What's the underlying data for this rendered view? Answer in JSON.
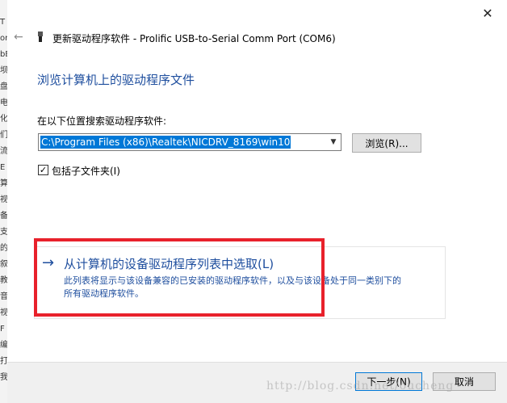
{
  "window": {
    "title": "更新驱动程序软件 - Prolific USB-to-Serial Comm Port (COM6)",
    "close_glyph": "✕",
    "back_glyph": "←"
  },
  "background_chars": [
    "T",
    "or",
    "bE",
    "坝",
    "盘",
    "电",
    "化",
    "们",
    "流",
    "E",
    "算",
    "视",
    "备",
    "支",
    "的",
    "叙",
    "教",
    "音",
    "视",
    "F",
    "编",
    "打",
    "我"
  ],
  "main": {
    "heading": "浏览计算机上的驱动程序文件",
    "search_label": "在以下位置搜索驱动程序软件:",
    "path_value": "C:\\Program Files (x86)\\Realtek\\NICDRV_8169\\win10",
    "browse_label": "浏览(R)...",
    "include_subfolders_label": "包括子文件夹(I)",
    "include_subfolders_checked": true
  },
  "pick_link": {
    "arrow": "→",
    "title": "从计算机的设备驱动程序列表中选取(L)",
    "desc_line1": "此列表将显示与该设备兼容的已安装的驱动程序软件，以及与该设备处于同一类别下的",
    "desc_line2": "所有驱动程序软件。"
  },
  "footer": {
    "next_label": "下一步(N)",
    "cancel_label": "取消"
  },
  "watermark": "http://blog.csdn.net/oucheng",
  "colors": {
    "heading_blue": "#1e4e9e",
    "selection_blue": "#0078d7",
    "annotation_red": "#e8212b"
  }
}
